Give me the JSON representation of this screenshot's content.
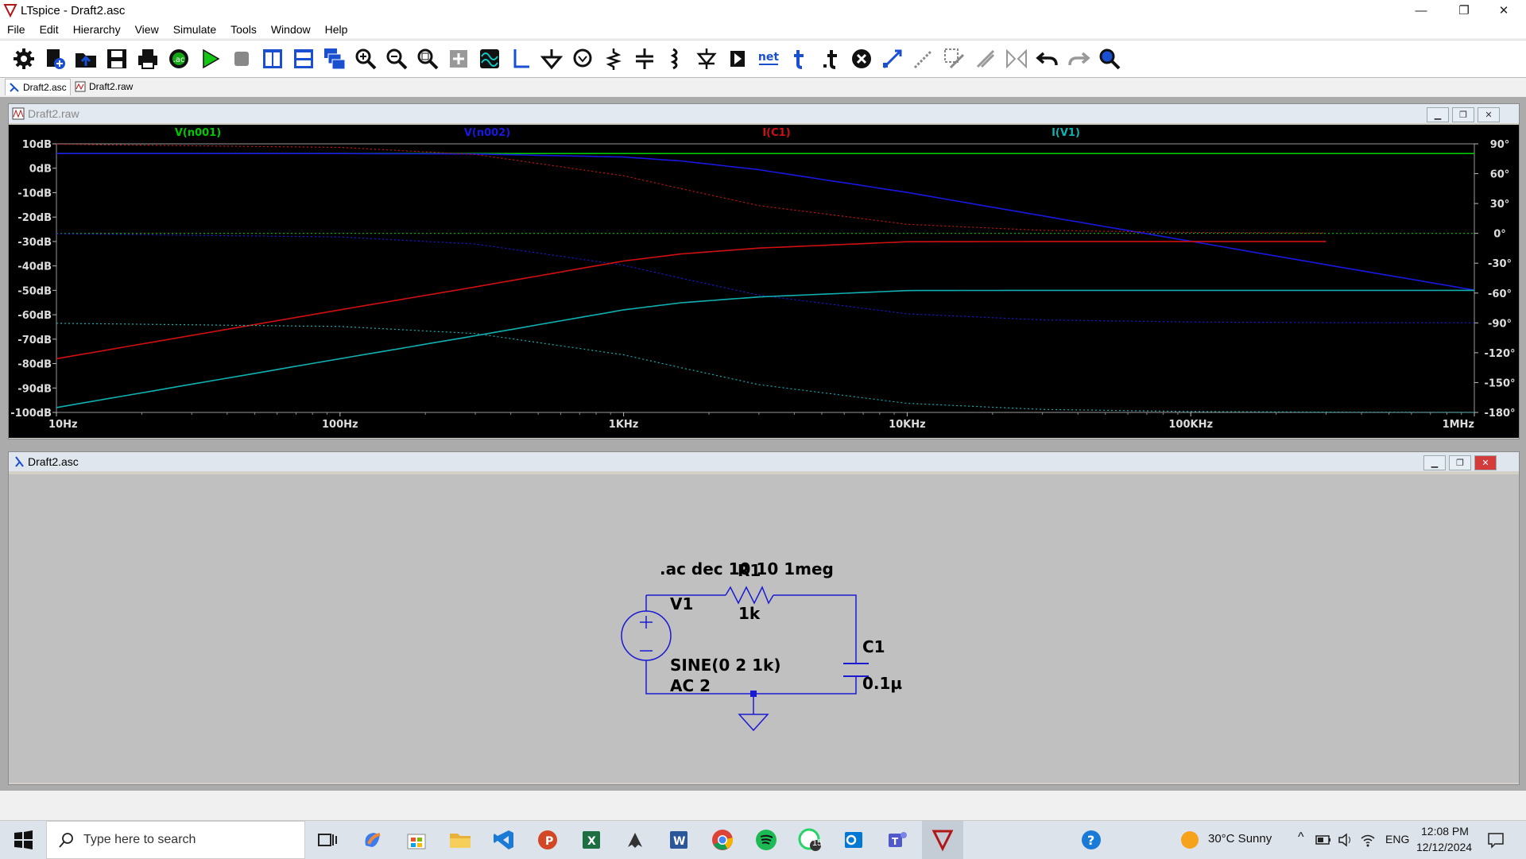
{
  "app": {
    "title": "LTspice - Draft2.asc"
  },
  "menu": [
    "File",
    "Edit",
    "Hierarchy",
    "View",
    "Simulate",
    "Tools",
    "Window",
    "Help"
  ],
  "toolbar": {
    "net_label": "net",
    "ac_label": ".ac"
  },
  "tabs": [
    {
      "label": "Draft2.asc"
    },
    {
      "label": "Draft2.raw"
    }
  ],
  "plot_window": {
    "title": "Draft2.raw"
  },
  "schematic_window": {
    "title": "Draft2.asc"
  },
  "chart_data": {
    "type": "line",
    "x_scale": "log",
    "xlim": [
      10,
      1000000
    ],
    "ylim_left": [
      -100,
      10
    ],
    "ylim_right": [
      -180,
      90
    ],
    "x_ticks": [
      "10Hz",
      "100Hz",
      "1KHz",
      "10KHz",
      "100KHz",
      "1MHz"
    ],
    "y_ticks_left": [
      "10dB",
      "0dB",
      "-10dB",
      "-20dB",
      "-30dB",
      "-40dB",
      "-50dB",
      "-60dB",
      "-70dB",
      "-80dB",
      "-90dB",
      "-100dB"
    ],
    "y_ticks_right": [
      "90°",
      "60°",
      "30°",
      "0°",
      "-30°",
      "-60°",
      "-90°",
      "-120°",
      "-150°",
      "-180°"
    ],
    "series": [
      {
        "name": "V(n001)",
        "color": "#00c800",
        "x": [
          10,
          1000000
        ],
        "mag_db": [
          6.02,
          6.02
        ],
        "phase_deg": [
          0,
          0
        ]
      },
      {
        "name": "V(n002)",
        "color": "#1818e0",
        "x": [
          10,
          100,
          300,
          1000,
          1592,
          3000,
          10000,
          30000,
          100000,
          300000,
          1000000
        ],
        "mag_db": [
          6.02,
          6.02,
          5.85,
          4.6,
          3.0,
          -0.6,
          -9.9,
          -19.5,
          -29.9,
          -39.5,
          -49.9
        ],
        "phase_deg": [
          -0.4,
          -3.6,
          -10.7,
          -32.1,
          -45,
          -62.1,
          -80.9,
          -87,
          -89.1,
          -89.7,
          -89.9
        ]
      },
      {
        "name": "I(C1)",
        "color": "#d01010",
        "x": [
          10,
          100,
          300,
          1000,
          1592,
          3000,
          10000,
          30000,
          100000,
          300000
        ],
        "mag_db": [
          -78.0,
          -58.0,
          -48.6,
          -38.0,
          -35.1,
          -32.7,
          -30.1,
          -30.0,
          -30.0,
          -30.0
        ],
        "phase_deg": [
          89.6,
          86.4,
          79.3,
          57.9,
          45,
          27.9,
          9.1,
          3.0,
          0.9,
          0.3
        ]
      },
      {
        "name": "I(V1)",
        "color": "#10b0b0",
        "x": [
          10,
          100,
          300,
          1000,
          1592,
          3000,
          10000,
          30000,
          100000,
          300000,
          1000000
        ],
        "mag_db": [
          -98.0,
          -78.0,
          -68.6,
          -58.0,
          -55.1,
          -52.7,
          -50.1,
          -50.0,
          -50.0,
          -50.0,
          -50.0
        ],
        "phase_deg": [
          -90.4,
          -93.6,
          -100.7,
          -122.1,
          -135,
          -152.1,
          -170.9,
          -177,
          -179.1,
          -179.7,
          -179.9
        ]
      }
    ]
  },
  "schematic": {
    "directive": ".ac dec 10 10 1meg",
    "r1_name": "R1",
    "r1_value": "1k",
    "v1_name": "V1",
    "v1_value": "SINE(0 2 1k)",
    "v1_ac": "AC 2",
    "c1_name": "C1",
    "c1_value": "0.1µ"
  },
  "taskbar": {
    "search_placeholder": "Type here to search",
    "weather": "30°C  Sunny",
    "lang": "ENG",
    "time": "12:08 PM",
    "date": "12/12/2024",
    "whatsapp_badge": "15"
  },
  "colors": {
    "plot_bg": "#000000",
    "schematic_bg": "#c0c0c0",
    "wire": "#1a1ad0"
  }
}
